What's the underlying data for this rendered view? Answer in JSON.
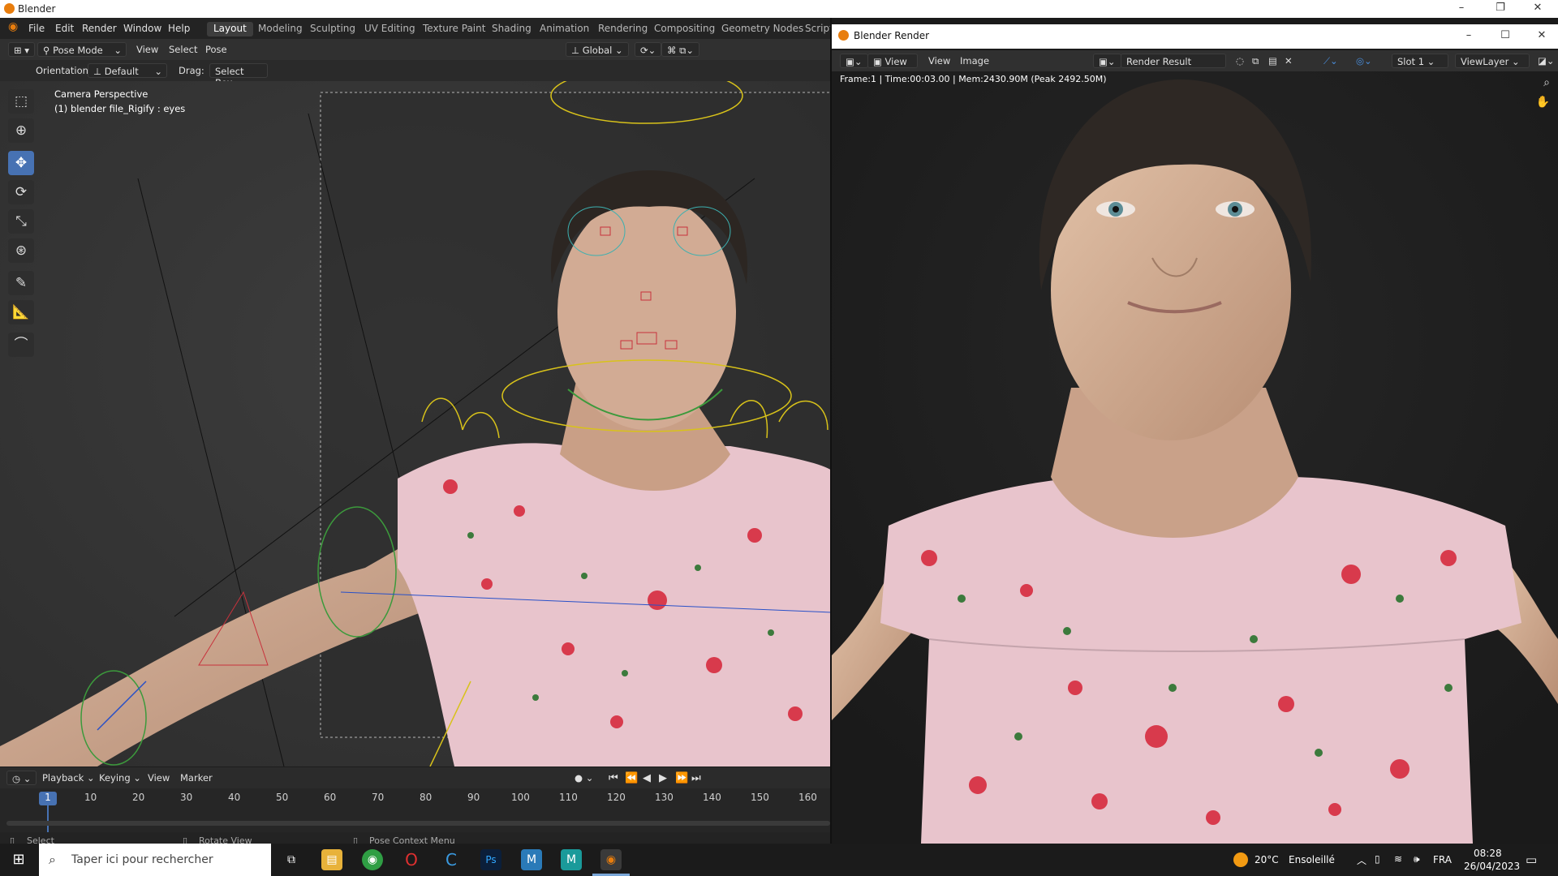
{
  "window": {
    "title": "Blender",
    "minimize": "–",
    "maximize": "❐",
    "close": "✕"
  },
  "menubar": {
    "items": [
      "File",
      "Edit",
      "Render",
      "Window",
      "Help"
    ],
    "workspaces": [
      "Layout",
      "Modeling",
      "Sculpting",
      "UV Editing",
      "Texture Paint",
      "Shading",
      "Animation",
      "Rendering",
      "Compositing",
      "Geometry Nodes",
      "Script"
    ],
    "active_workspace": "Layout"
  },
  "viewport_header": {
    "mode": "Pose Mode",
    "menus": [
      "View",
      "Select",
      "Pose"
    ],
    "transform_orientation": "Global",
    "orientation_label": "Orientation:",
    "orientation_value": "Default",
    "drag_label": "Drag:",
    "drag_value": "Select Box"
  },
  "viewport_overlay": {
    "line1": "Camera Perspective",
    "line2": "(1) blender file_Rigify : eyes"
  },
  "toolbar": {
    "tools": [
      "select-box",
      "cursor",
      "move",
      "rotate",
      "scale",
      "transform",
      "annotate",
      "measure",
      "pose-relax"
    ],
    "active_tool": "move"
  },
  "timeline": {
    "menus": [
      "Playback",
      "Keying",
      "View",
      "Marker"
    ],
    "current_frame": "1",
    "ticks": [
      "10",
      "20",
      "30",
      "40",
      "50",
      "60",
      "70",
      "80",
      "90",
      "100",
      "110",
      "120",
      "130",
      "140",
      "150",
      "160"
    ]
  },
  "statusbar": {
    "select": "Select",
    "rotate": "Rotate View",
    "context": "Pose Context Menu"
  },
  "render_window": {
    "title": "Blender Render",
    "menus": [
      "View",
      "View",
      "Image"
    ],
    "image_name": "Render Result",
    "slot": "Slot 1",
    "view_layer": "ViewLayer",
    "info": "Frame:1 | Time:00:03.00 | Mem:2430.90M (Peak 2492.50M)"
  },
  "taskbar": {
    "search_placeholder": "Taper ici pour rechercher",
    "weather_temp": "20°C",
    "weather_text": "Ensoleillé",
    "language": "FRA",
    "time": "08:28",
    "date": "26/04/2023"
  },
  "colors": {
    "accent": "#4772b3",
    "blender_orange": "#e87d0d",
    "dress_pink": "#e8c4cc",
    "rig_yellow": "#d8c21a",
    "rig_green": "#3c9a3c",
    "rig_red": "#c8323c"
  }
}
